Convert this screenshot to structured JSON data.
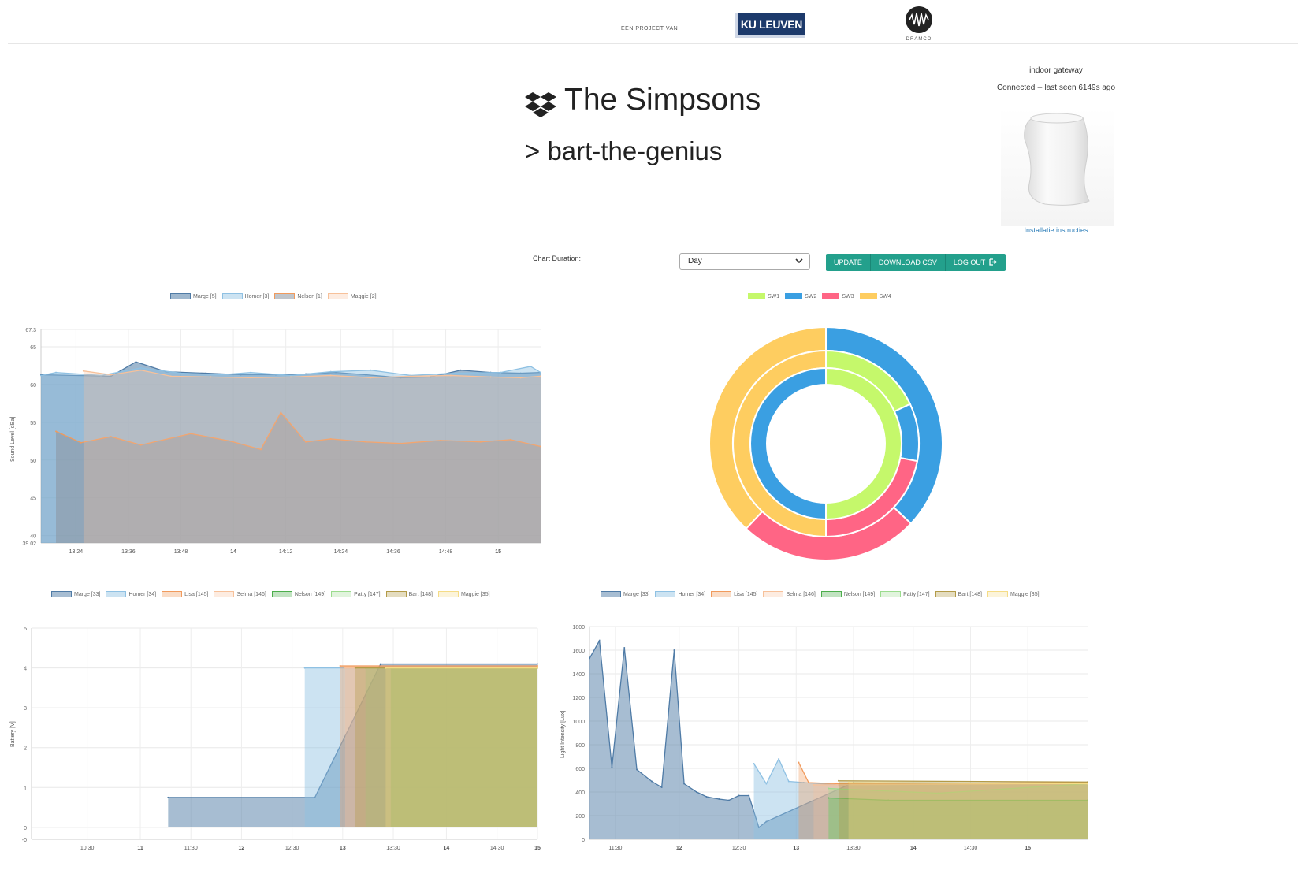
{
  "header": {
    "project_label": "EEN PROJECT VAN",
    "kul_logo_text": "KU LEUVEN",
    "dramco_logo_text": "DRAMCO"
  },
  "page": {
    "title": "The Simpsons",
    "subtitle": "> bart-the-genius"
  },
  "gateway": {
    "name": "indoor gateway",
    "status": "Connected -- last seen 6149s ago",
    "link": "Installatie instructies"
  },
  "controls": {
    "duration_label": "Chart Duration:",
    "duration_value": "Day",
    "update": "UPDATE",
    "download": "DOWNLOAD CSV",
    "logout": "LOG OUT",
    "accent": "#23a08c"
  },
  "chart_data": [
    {
      "id": "sound",
      "type": "area",
      "ylabel": "Sound Level [dBa]",
      "ylim": [
        39.02,
        67.3
      ],
      "yticks": [
        "67.3",
        "65",
        "60",
        "55",
        "50",
        "45",
        "40",
        "39.02"
      ],
      "yvals": [
        67.3,
        65,
        60,
        55,
        50,
        45,
        40,
        39.02
      ],
      "xlabels": [
        {
          "label": "13:24",
          "t": 0.07
        },
        {
          "label": "13:36",
          "t": 0.175
        },
        {
          "label": "13:48",
          "t": 0.28
        },
        {
          "label": "14",
          "t": 0.385
        },
        {
          "label": "14:12",
          "t": 0.49
        },
        {
          "label": "14:24",
          "t": 0.6
        },
        {
          "label": "14:36",
          "t": 0.705
        },
        {
          "label": "14:48",
          "t": 0.81
        },
        {
          "label": "15",
          "t": 0.915
        }
      ],
      "series": [
        {
          "name": "Marge [5]",
          "color": "#4f7ba6",
          "fill": "rgba(79,123,166,0.55)",
          "t": [
            0,
            0.14,
            0.19,
            0.25,
            0.33,
            0.4,
            0.47,
            0.53,
            0.59,
            0.65,
            0.72,
            0.78,
            0.84,
            0.9,
            0.96,
            1.0
          ],
          "values": [
            61.3,
            61.1,
            63.0,
            61.7,
            61.5,
            61.3,
            61.3,
            61.4,
            61.6,
            61.3,
            60.9,
            61.0,
            61.9,
            61.6,
            61.5,
            61.6
          ]
        },
        {
          "name": "Homer [3]",
          "color": "#8fc1e3",
          "fill": "rgba(143,193,227,0.45)",
          "t": [
            0,
            0.03,
            0.12,
            0.2,
            0.28,
            0.36,
            0.42,
            0.5,
            0.58,
            0.66,
            0.74,
            0.83,
            0.92,
            0.98,
            1.0
          ],
          "values": [
            61.2,
            61.6,
            61.2,
            62.2,
            61.5,
            61.3,
            61.6,
            61.2,
            61.7,
            61.9,
            61.2,
            61.5,
            61.6,
            62.4,
            61.6
          ]
        },
        {
          "name": "Nelson [1]",
          "color": "#f19a5c",
          "fill": "rgba(140,150,160,0.55)",
          "t": [
            0.03,
            0.08,
            0.14,
            0.2,
            0.3,
            0.38,
            0.44,
            0.48,
            0.53,
            0.58,
            0.65,
            0.72,
            0.8,
            0.88,
            0.94,
            1.0
          ],
          "values": [
            53.8,
            52.3,
            53.1,
            52.0,
            53.5,
            52.5,
            51.4,
            56.3,
            52.4,
            52.8,
            52.4,
            52.2,
            52.6,
            52.4,
            52.7,
            51.8
          ]
        },
        {
          "name": "Maggie [2]",
          "color": "#f7c19a",
          "fill": "rgba(247,193,154,0.3)",
          "t": [
            0.085,
            0.14,
            0.2,
            0.26,
            0.34,
            0.42,
            0.5,
            0.58,
            0.66,
            0.74,
            0.82,
            0.9,
            0.96,
            1.0
          ],
          "values": [
            61.8,
            61.3,
            61.9,
            61.1,
            61.0,
            60.9,
            61.0,
            61.2,
            60.9,
            61.1,
            61.2,
            61.0,
            60.9,
            61.1
          ]
        }
      ]
    },
    {
      "id": "switches",
      "type": "pie",
      "subtype": "doughnut",
      "categories": [
        "SW1",
        "SW2",
        "SW3",
        "SW4"
      ],
      "colors": [
        "#c5f86b",
        "#3a9fe2",
        "#ff6585",
        "#fecd60"
      ],
      "rings": [
        {
          "name": "outer",
          "values": [
            0,
            37,
            25,
            38
          ]
        },
        {
          "name": "middle",
          "values": [
            18,
            10,
            22,
            50
          ]
        },
        {
          "name": "inner",
          "values": [
            50,
            50,
            0,
            0
          ]
        }
      ]
    },
    {
      "id": "battery",
      "type": "area",
      "ylabel": "Battery [V]",
      "ylim": [
        -0.3,
        5
      ],
      "yticks": [
        "5",
        "4",
        "3",
        "2",
        "1",
        "0",
        "-0"
      ],
      "yvals": [
        5,
        4,
        3,
        2,
        1,
        0,
        -0.3
      ],
      "xlabels": [
        {
          "label": "10:30",
          "t": 0.11
        },
        {
          "label": "11",
          "t": 0.215
        },
        {
          "label": "11:30",
          "t": 0.315
        },
        {
          "label": "12",
          "t": 0.415
        },
        {
          "label": "12:30",
          "t": 0.515
        },
        {
          "label": "13",
          "t": 0.615
        },
        {
          "label": "13:30",
          "t": 0.715
        },
        {
          "label": "14",
          "t": 0.82
        },
        {
          "label": "14:30",
          "t": 0.92
        },
        {
          "label": "15",
          "t": 1.0
        }
      ],
      "series": [
        {
          "name": "Marge [33]",
          "color": "#4f7ba6",
          "fill": "rgba(79,123,166,0.5)",
          "t": [
            0.27,
            0.56,
            0.69,
            1.0
          ],
          "values": [
            0.75,
            0.75,
            4.1,
            4.1
          ]
        },
        {
          "name": "Homer [34]",
          "color": "#8fc1e3",
          "fill": "rgba(143,193,227,0.45)",
          "t": [
            0.54,
            1.0
          ],
          "values": [
            4.0,
            4.0
          ]
        },
        {
          "name": "Lisa [145]",
          "color": "#f19a5c",
          "fill": "rgba(241,154,92,0.35)",
          "t": [
            0.61,
            1.0
          ],
          "values": [
            4.05,
            4.05
          ]
        },
        {
          "name": "Selma [146]",
          "color": "#f7c19a",
          "fill": "rgba(247,193,154,0.3)",
          "t": [
            0.62,
            1.0
          ],
          "values": [
            4.0,
            4.0
          ]
        },
        {
          "name": "Nelson [149]",
          "color": "#4cae4c",
          "fill": "rgba(76,174,76,0.35)",
          "t": [
            0.71,
            1.0
          ],
          "values": [
            4.0,
            4.0
          ]
        },
        {
          "name": "Patty [147]",
          "color": "#9bdc8e",
          "fill": "rgba(155,220,142,0.3)",
          "t": [
            0.66,
            1.0
          ],
          "values": [
            4.0,
            4.0
          ]
        },
        {
          "name": "Bart [148]",
          "color": "#b39b48",
          "fill": "rgba(179,155,72,0.35)",
          "t": [
            0.64,
            1.0
          ],
          "values": [
            4.0,
            4.0
          ]
        },
        {
          "name": "Maggie [35]",
          "color": "#f5dc86",
          "fill": "rgba(245,220,134,0.3)",
          "t": [
            0.7,
            1.0
          ],
          "values": [
            4.0,
            4.0
          ]
        }
      ]
    },
    {
      "id": "light",
      "type": "area",
      "ylabel": "Light Intensity [Lux]",
      "ylim": [
        0,
        1800
      ],
      "yticks": [
        "1800",
        "1600",
        "1400",
        "1200",
        "1000",
        "800",
        "600",
        "400",
        "200",
        "0"
      ],
      "yvals": [
        1800,
        1600,
        1400,
        1200,
        1000,
        800,
        600,
        400,
        200,
        0
      ],
      "xlabels": [
        {
          "label": "11:30",
          "t": 0.052
        },
        {
          "label": "12",
          "t": 0.18
        },
        {
          "label": "12:30",
          "t": 0.3
        },
        {
          "label": "13",
          "t": 0.415
        },
        {
          "label": "13:30",
          "t": 0.53
        },
        {
          "label": "14",
          "t": 0.65
        },
        {
          "label": "14:30",
          "t": 0.765
        },
        {
          "label": "15",
          "t": 0.88
        }
      ],
      "series": [
        {
          "name": "Marge [33]",
          "color": "#4f7ba6",
          "fill": "rgba(79,123,166,0.5)",
          "t": [
            0,
            0.02,
            0.045,
            0.07,
            0.095,
            0.125,
            0.145,
            0.17,
            0.19,
            0.215,
            0.235,
            0.26,
            0.28,
            0.3,
            0.32,
            0.34,
            0.355,
            0.53,
            1.0
          ],
          "values": [
            1530,
            1680,
            610,
            1620,
            590,
            490,
            440,
            1600,
            470,
            400,
            360,
            340,
            330,
            370,
            370,
            100,
            150,
            480,
            470
          ]
        },
        {
          "name": "Homer [34]",
          "color": "#8fc1e3",
          "fill": "rgba(143,193,227,0.45)",
          "t": [
            0.33,
            0.355,
            0.38,
            0.4,
            0.43,
            0.5,
            1.0
          ],
          "values": [
            640,
            470,
            680,
            490,
            480,
            460,
            470
          ]
        },
        {
          "name": "Lisa [145]",
          "color": "#f19a5c",
          "fill": "rgba(241,154,92,0.35)",
          "t": [
            0.42,
            0.44,
            0.5,
            1.0
          ],
          "values": [
            650,
            480,
            470,
            480
          ]
        },
        {
          "name": "Selma [146]",
          "color": "#f7c19a",
          "fill": "rgba(247,193,154,0.3)",
          "t": [
            0.45,
            1.0
          ],
          "values": [
            460,
            470
          ]
        },
        {
          "name": "Nelson [149]",
          "color": "#4cae4c",
          "fill": "rgba(76,174,76,0.35)",
          "t": [
            0.48,
            0.6,
            1.0
          ],
          "values": [
            350,
            330,
            330
          ]
        },
        {
          "name": "Patty [147]",
          "color": "#9bdc8e",
          "fill": "rgba(155,220,142,0.3)",
          "t": [
            0.48,
            0.7,
            1.0
          ],
          "values": [
            430,
            390,
            470
          ]
        },
        {
          "name": "Bart [148]",
          "color": "#b39b48",
          "fill": "rgba(179,155,72,0.35)",
          "t": [
            0.5,
            1.0
          ],
          "values": [
            495,
            485
          ]
        },
        {
          "name": "Maggie [35]",
          "color": "#f5dc86",
          "fill": "rgba(245,220,134,0.3)",
          "t": [
            0.52,
            1.0
          ],
          "values": [
            480,
            470
          ]
        }
      ]
    }
  ]
}
